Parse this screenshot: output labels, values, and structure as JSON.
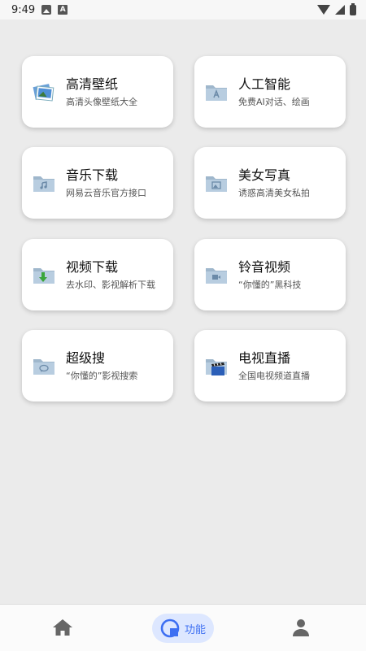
{
  "status_bar": {
    "time": "9:49"
  },
  "cards": [
    {
      "title": "高清壁纸",
      "subtitle": "高清头像壁纸大全",
      "icon": "wallpaper-icon"
    },
    {
      "title": "人工智能",
      "subtitle": "免费AI对话、绘画",
      "icon": "ai-folder-icon"
    },
    {
      "title": "音乐下载",
      "subtitle": "网易云音乐官方接口",
      "icon": "music-folder-icon"
    },
    {
      "title": "美女写真",
      "subtitle": "诱惑高清美女私拍",
      "icon": "photo-folder-icon"
    },
    {
      "title": "视频下载",
      "subtitle": "去水印、影视解析下载",
      "icon": "download-folder-icon"
    },
    {
      "title": "铃音视频",
      "subtitle": "“你懂的”黑科技",
      "icon": "video-folder-icon"
    },
    {
      "title": "超级搜",
      "subtitle": "“你懂的”影视搜索",
      "icon": "chat-folder-icon"
    },
    {
      "title": "电视直播",
      "subtitle": "全国电视频道直播",
      "icon": "clapper-folder-icon"
    }
  ],
  "bottom_nav": {
    "items": [
      {
        "icon": "home-icon"
      },
      {
        "icon": "function-icon",
        "label": "功能",
        "active": true
      },
      {
        "icon": "user-icon"
      }
    ],
    "accent": "#3d6ff2"
  }
}
